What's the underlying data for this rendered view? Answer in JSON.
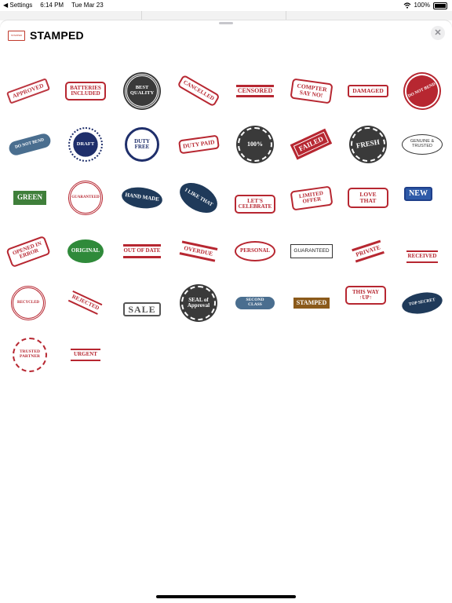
{
  "status_bar": {
    "back_app": "◀ Settings",
    "time": "6:14 PM",
    "date": "Tue Mar 23",
    "wifi": "wifi-icon",
    "battery": "100%"
  },
  "header": {
    "icon_text": "STAMPED",
    "title": "STAMPED",
    "close_label": "✕"
  },
  "colors": {
    "red": "#b72731",
    "navy": "#1f2f6b",
    "steel": "#4a6e8f",
    "dark": "#3a3a3a",
    "green": "#2f8a3a",
    "brown": "#8b5a1a"
  },
  "stickers": [
    {
      "label": "APPROVED"
    },
    {
      "label": "BATTERIES INCLUDED"
    },
    {
      "label": "BEST QUALITY"
    },
    {
      "label": "CANCELLED"
    },
    {
      "label": "CENSORED"
    },
    {
      "label": "COMPTER SAY NO!"
    },
    {
      "label": "DAMAGED"
    },
    {
      "label": "DO NOT BEND"
    },
    {
      "label": "DO NOT BEND"
    },
    {
      "label": "DRAFT"
    },
    {
      "label": "DUTY FREE"
    },
    {
      "label": "DUTY PAID"
    },
    {
      "label": "100%"
    },
    {
      "label": "FAILED"
    },
    {
      "label": "FRESH"
    },
    {
      "label": "GENUINE & TRUSTED"
    },
    {
      "label": "GREEN"
    },
    {
      "label": "GUARANTEED"
    },
    {
      "label": "HAND MADE"
    },
    {
      "label": "I LIKE THAT"
    },
    {
      "label": "LET'S CELEBRATE"
    },
    {
      "label": "LIMITED OFFER"
    },
    {
      "label": "LOVE THAT"
    },
    {
      "label": "NEW"
    },
    {
      "label": "OPENED IN ERROR"
    },
    {
      "label": "ORIGINAL"
    },
    {
      "label": "OUT OF DATE"
    },
    {
      "label": "OVERDUE"
    },
    {
      "label": "PERSONAL"
    },
    {
      "label": "GUARANTEED"
    },
    {
      "label": "PRIVATE"
    },
    {
      "label": "RECEIVED"
    },
    {
      "label": "RECYCLED"
    },
    {
      "label": "REJECTED"
    },
    {
      "label": "SALE"
    },
    {
      "label": "SEAL of Approval"
    },
    {
      "label": "SECOND CLASS"
    },
    {
      "label": "STAMPED"
    },
    {
      "label": "THIS WAY ↑UP↑"
    },
    {
      "label": "TOP SECRET"
    },
    {
      "label": "TRUSTED PARTNER"
    },
    {
      "label": "URGENT"
    }
  ]
}
